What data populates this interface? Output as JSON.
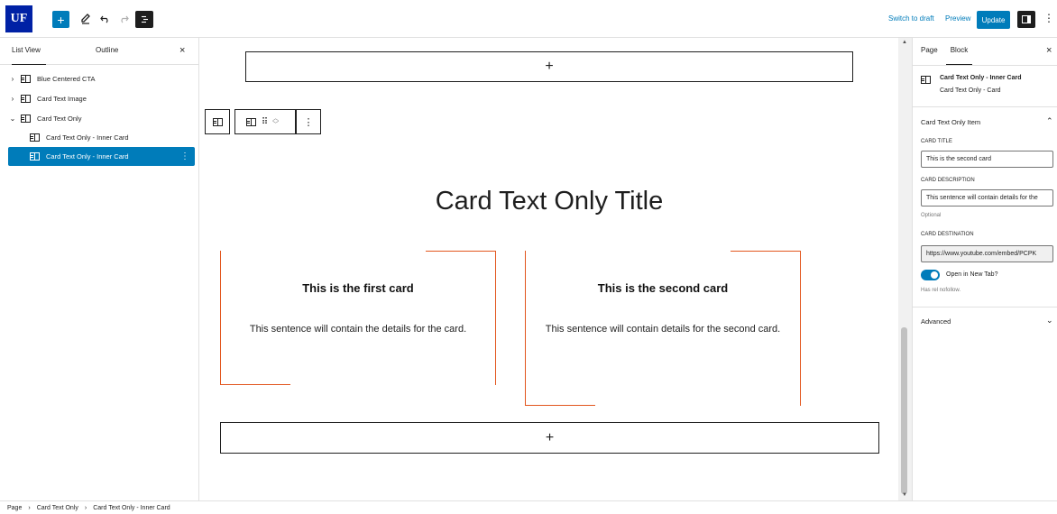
{
  "toolbar": {
    "logo": "UF",
    "inserter_icon": "+",
    "tools_icon": "pencil",
    "undo_icon": "undo",
    "redo_icon": "redo",
    "overview_icon": "list-view",
    "switch_to_draft": "Switch to draft",
    "preview": "Preview",
    "update": "Update",
    "settings_icon": "sidebar",
    "more_icon": "⋮"
  },
  "list_view": {
    "tabs": [
      "List View",
      "Outline"
    ],
    "close": "×",
    "items": [
      {
        "label": "Blue Centered CTA",
        "chevron": "›"
      },
      {
        "label": "Card Text Image",
        "chevron": "›"
      },
      {
        "label": "Card Text Only",
        "chevron": "⌄"
      },
      {
        "label": "Card Text Only - Inner Card",
        "chevron": ""
      },
      {
        "label": "Card Text Only - Inner Card",
        "chevron": "",
        "selected": true
      }
    ]
  },
  "canvas": {
    "appender_top": "+",
    "appender_bottom": "+",
    "heading": "Card Text Only Title",
    "cards": [
      {
        "title": "This is the first card",
        "desc": "This sentence will contain the details for the card."
      },
      {
        "title": "This is the second card",
        "desc": "This sentence will contain details for the second card."
      }
    ],
    "block_toolbar_more": "⋮"
  },
  "settings": {
    "tabs": [
      "Page",
      "Block"
    ],
    "close": "×",
    "block_name": "Card Text Only - Inner Card",
    "block_parent": "Card Text Only - Card",
    "section_title": "Card Text Only Item",
    "card_title_label": "Card Title",
    "card_title_value": "This is the second card",
    "card_desc_label": "Card Description",
    "card_desc_value": "This sentence will contain details for the",
    "optional": "Optional",
    "card_dest_label": "Card Destination",
    "card_dest_value": "https://www.youtube.com/embed/PCPK",
    "new_tab_label": "Open in New Tab?",
    "new_tab_checked": true,
    "rel_help": "Has rel nofollow.",
    "advanced": "Advanced"
  },
  "breadcrumb": [
    "Page",
    "Card Text Only",
    "Card Text Only - Inner Card"
  ],
  "colors": {
    "accent": "#007cba",
    "card_border": "#e2561e",
    "logo": "#0021a5"
  }
}
